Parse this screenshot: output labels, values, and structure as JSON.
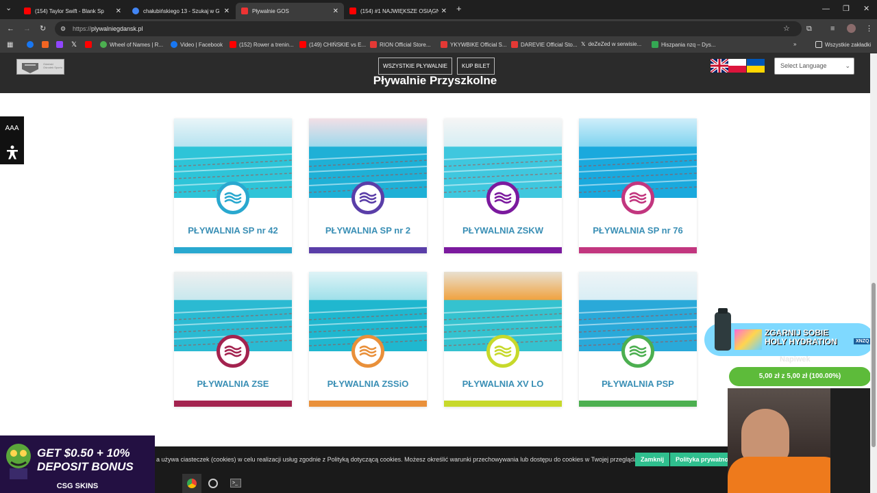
{
  "browser": {
    "tabs": [
      {
        "title": "(154) Taylor Swift - Blank Sp",
        "active": false,
        "favicon_color": "#ff0000"
      },
      {
        "title": "chałubińskiego 13 - Szukaj w G",
        "active": false,
        "favicon_color": "#4285f4"
      },
      {
        "title": "Pływalnie GOS",
        "active": true,
        "favicon_color": "#e33"
      },
      {
        "title": "(154) #1 NAJWIĘKSZE OSIĄGNI",
        "active": false,
        "favicon_color": "#ff0000"
      }
    ],
    "new_tab": "+",
    "url_scheme": "https://",
    "url_host": "plywalniegdansk.pl",
    "bookmarks": [
      {
        "label": "",
        "color": "#1877f2"
      },
      {
        "label": "",
        "color": "#f26522"
      },
      {
        "label": "",
        "color": "#9146ff"
      },
      {
        "label": "",
        "color": "#000000"
      },
      {
        "label": "",
        "color": "#ff0000"
      },
      {
        "label": "Wheel of Names | R...",
        "color": "#4caf50"
      },
      {
        "label": "Video | Facebook",
        "color": "#1877f2"
      },
      {
        "label": "(152) Rower a trenin...",
        "color": "#ff0000"
      },
      {
        "label": "(149) CHIŃSKIE vs E...",
        "color": "#ff0000"
      },
      {
        "label": "RION Official Store...",
        "color": "#e53935"
      },
      {
        "label": "YKYWBIKE Official S...",
        "color": "#e53935"
      },
      {
        "label": "DAREVIE Official Sto...",
        "color": "#e53935"
      },
      {
        "label": "deZeZed w serwisie...",
        "color": "#000000"
      },
      {
        "label": "Hiszpania nzq – Dys...",
        "color": "#34a853"
      }
    ],
    "all_bookmarks": "Wszystkie zakładki"
  },
  "site": {
    "nav": [
      "WSZYSTKIE PŁYWALNIE",
      "KUP BILET"
    ],
    "heading": "Pływalnie Przyszkolne",
    "language_select": "Select Language",
    "font_size_control": "AAA",
    "logo_text": "Gdański Ośrodek Sportu"
  },
  "pools": [
    {
      "name": "PŁYWALNIA SP nr 42",
      "color": "#29a8cf"
    },
    {
      "name": "PŁYWALNIA SP nr 2",
      "color": "#5a3ea8"
    },
    {
      "name": "PŁYWALNIA ZSKW",
      "color": "#7b1a9e"
    },
    {
      "name": "PŁYWALNIA SP nr 76",
      "color": "#c2367f"
    },
    {
      "name": "PŁYWALNIA ZSE",
      "color": "#a3234f"
    },
    {
      "name": "PŁYWALNIA ZSSiO",
      "color": "#e9903a"
    },
    {
      "name": "PŁYWALNIA XV LO",
      "color": "#c7d92b"
    },
    {
      "name": "PŁYWALNIA PSP",
      "color": "#4caf50"
    }
  ],
  "cookie": {
    "message": "a używa ciasteczek (cookies) w celu realizacji usług zgodnie z Polityką dotyczącą cookies. Możesz określić warunki przechowywania lub dostępu do cookies w Twojej przeglądarce.",
    "close": "Zamknij",
    "policy": "Polityka prywatności"
  },
  "overlays": {
    "ad_line1": "GET $0.50 + 10%",
    "ad_line2": "DEPOSIT BONUS",
    "ad_brand": "CSG SKINS",
    "promo_line1": "ZGARNIJ SOBIE",
    "promo_line2": "HOLY HYDRATION",
    "promo_code": "XNZQ",
    "promo_caption": "Napiwek",
    "donation": "5,00 zł z 5,00 zł (100.00%)"
  }
}
